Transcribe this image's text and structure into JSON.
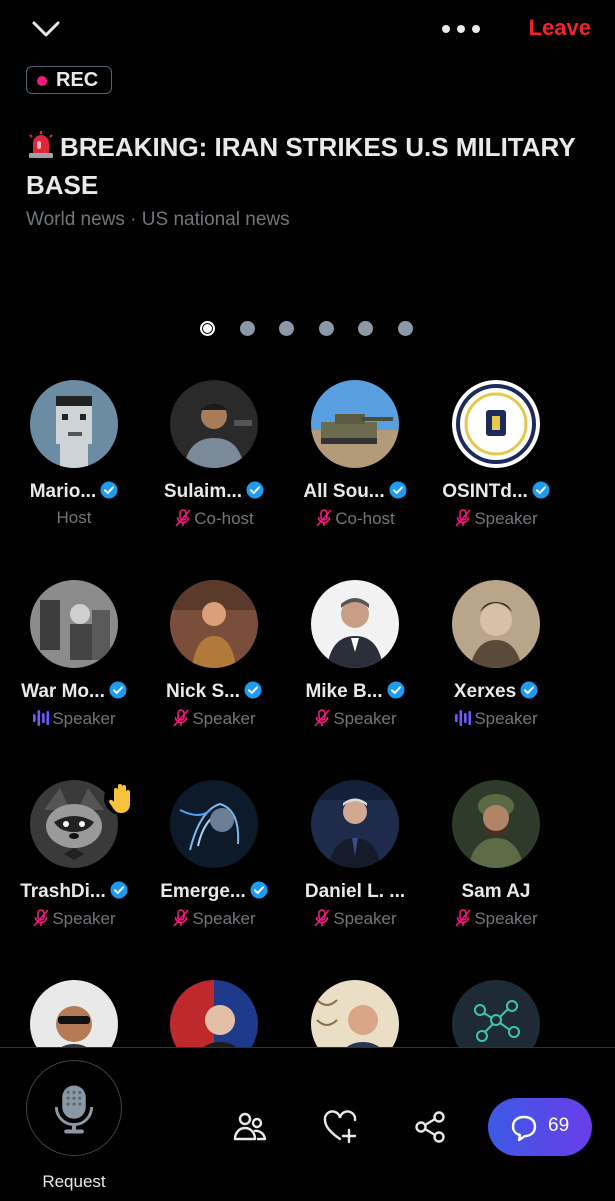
{
  "header": {
    "leave_label": "Leave"
  },
  "rec_label": "REC",
  "space": {
    "title": "BREAKING: IRAN STRIKES U.S MILITARY BASE",
    "topics": "World news · US national news"
  },
  "pager": {
    "count": 6,
    "active": 1
  },
  "participants": [
    {
      "name": "Mario...",
      "role": "Host",
      "verified": true,
      "mic": "none"
    },
    {
      "name": "Sulaim...",
      "role": "Co-host",
      "verified": true,
      "mic": "muted"
    },
    {
      "name": "All Sou...",
      "role": "Co-host",
      "verified": true,
      "mic": "muted"
    },
    {
      "name": "OSINTd...",
      "role": "Speaker",
      "verified": true,
      "mic": "muted"
    },
    {
      "name": "War Mo...",
      "role": "Speaker",
      "verified": true,
      "mic": "speaking"
    },
    {
      "name": "Nick S...",
      "role": "Speaker",
      "verified": true,
      "mic": "muted"
    },
    {
      "name": "Mike B...",
      "role": "Speaker",
      "verified": true,
      "mic": "muted"
    },
    {
      "name": "Xerxes",
      "role": "Speaker",
      "verified": true,
      "mic": "speaking"
    },
    {
      "name": "TrashDi...",
      "role": "Speaker",
      "verified": true,
      "mic": "muted",
      "hand_raised": true
    },
    {
      "name": "Emerge...",
      "role": "Speaker",
      "verified": true,
      "mic": "muted"
    },
    {
      "name": "Daniel L. ...",
      "role": "Speaker",
      "verified": false,
      "mic": "muted"
    },
    {
      "name": "Sam AJ",
      "role": "Speaker",
      "verified": false,
      "mic": "muted"
    },
    {
      "name": "",
      "role": "",
      "verified": false,
      "mic": "none"
    },
    {
      "name": "",
      "role": "",
      "verified": false,
      "mic": "none"
    },
    {
      "name": "",
      "role": "",
      "verified": false,
      "mic": "none"
    },
    {
      "name": "",
      "role": "",
      "verified": false,
      "mic": "none"
    }
  ],
  "bottom": {
    "request_label": "Request",
    "chat_count": "69"
  },
  "colors": {
    "leave": "#f4212e",
    "verified": "#1d9bf0",
    "muted_mic": "#f91880",
    "speaking": "#7856ff",
    "chat_button": "#5847e8"
  }
}
